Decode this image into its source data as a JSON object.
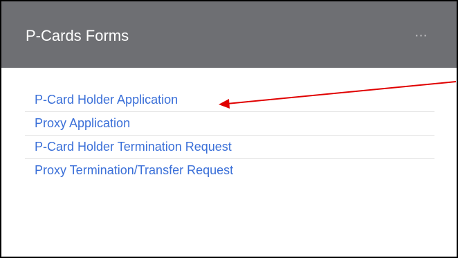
{
  "header": {
    "title": "P-Cards Forms",
    "menu_label": "···"
  },
  "links": [
    {
      "label": "P-Card Holder Application"
    },
    {
      "label": "Proxy Application"
    },
    {
      "label": "P-Card Holder Termination Request"
    },
    {
      "label": "Proxy Termination/Transfer Request"
    }
  ],
  "colors": {
    "header_bg": "#6e6f73",
    "link": "#3a6fd8",
    "annotation_arrow": "#e00000"
  }
}
